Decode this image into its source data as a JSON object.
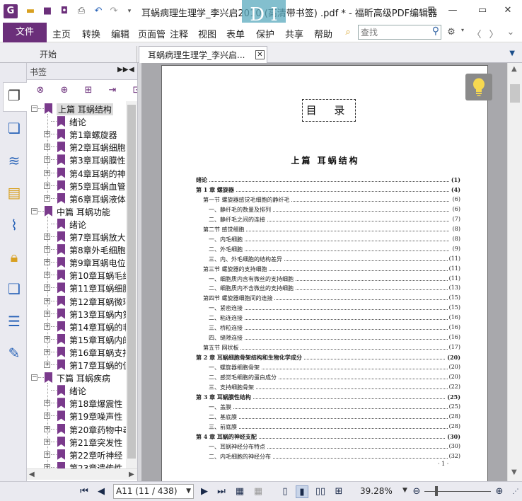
{
  "titlebar": {
    "app_icon": "G",
    "title": "耳蜗病理生理学_李兴启2010 (高清带书签) .pdf * - 福昕高级PDF编辑器",
    "overlay_text": "D  I",
    "icons": [
      "folder-icon",
      "save-icon",
      "save-as-icon",
      "print-icon",
      "undo-icon",
      "redo-icon",
      "quick-access-dropdown-icon"
    ],
    "window_icons": [
      "ribbon-options-icon",
      "minimize-icon",
      "maximize-icon",
      "close-icon"
    ]
  },
  "menubar": {
    "file": "文件",
    "items": [
      "主页",
      "转换",
      "编辑",
      "页面管",
      "注释",
      "视图",
      "表单",
      "保护",
      "共享",
      "帮助"
    ],
    "search_placeholder": "查找"
  },
  "tabs": [
    {
      "label": "开始"
    },
    {
      "label": "耳蜗病理生理学_李兴启..."
    }
  ],
  "bookmarks": {
    "header": "书签",
    "tree": [
      {
        "label": "上篇  耳蜗结构",
        "level": 0,
        "expanded": true,
        "selected": true
      },
      {
        "label": "绪论",
        "level": 1,
        "leaf": true
      },
      {
        "label": "第1章螺旋器",
        "level": 1
      },
      {
        "label": "第2章耳蜗细胞",
        "level": 1
      },
      {
        "label": "第3章耳蜗膜性",
        "level": 1
      },
      {
        "label": "第4章耳蜗的神",
        "level": 1
      },
      {
        "label": "第5章耳蜗血管",
        "level": 1
      },
      {
        "label": "第6章耳蜗液体",
        "level": 1
      },
      {
        "label": "中篇  耳蜗功能",
        "level": 0,
        "expanded": true
      },
      {
        "label": "绪论",
        "level": 1,
        "leaf": true
      },
      {
        "label": "第7章耳蜗放大",
        "level": 1
      },
      {
        "label": "第8章外毛细胞",
        "level": 1
      },
      {
        "label": "第9章耳蜗电位",
        "level": 1
      },
      {
        "label": "第10章耳蜗毛细",
        "level": 1
      },
      {
        "label": "第11章耳蜗细胞",
        "level": 1
      },
      {
        "label": "第12章耳蜗微环",
        "level": 1
      },
      {
        "label": "第13章耳蜗内第",
        "level": 1
      },
      {
        "label": "第14章耳蜗的非",
        "level": 1
      },
      {
        "label": "第15章耳蜗内的",
        "level": 1
      },
      {
        "label": "第16章耳蜗支持",
        "level": 1
      },
      {
        "label": "第17章耳蜗的值",
        "level": 1
      },
      {
        "label": "下篇  耳蜗疾病",
        "level": 0,
        "expanded": true
      },
      {
        "label": "绪论",
        "level": 1,
        "leaf": true
      },
      {
        "label": "第18章爆震性",
        "level": 1
      },
      {
        "label": "第19章噪声性",
        "level": 1
      },
      {
        "label": "第20章药物中毒",
        "level": 1
      },
      {
        "label": "第21章突发性",
        "level": 1
      },
      {
        "label": "第22章听神经",
        "level": 1
      },
      {
        "label": "第23章遗传性",
        "level": 1
      }
    ]
  },
  "document": {
    "page_title": "目 录",
    "part_title": "上篇  耳蜗结构",
    "toc": [
      {
        "label": "绪论",
        "page": "(1)",
        "indent": 0,
        "bold": true
      },
      {
        "label": "第 1 章   螺旋器",
        "page": "(4)",
        "indent": 0,
        "bold": true
      },
      {
        "label": "第一节   螺旋器感觉毛细胞的静纤毛",
        "page": "(6)",
        "indent": 1
      },
      {
        "label": "一、静纤毛的数量及排列",
        "page": "(6)",
        "indent": 2
      },
      {
        "label": "二、静纤毛之间的连接",
        "page": "(7)",
        "indent": 2
      },
      {
        "label": "第二节   感觉细胞",
        "page": "(8)",
        "indent": 1
      },
      {
        "label": "一、内毛细胞",
        "page": "(8)",
        "indent": 2
      },
      {
        "label": "二、外毛细胞",
        "page": "(9)",
        "indent": 2
      },
      {
        "label": "三、内、外毛细胞的结构差异",
        "page": "(11)",
        "indent": 2
      },
      {
        "label": "第三节   螺旋器的支持细胞",
        "page": "(11)",
        "indent": 1
      },
      {
        "label": "一、细胞质内含有微丝的支持细胞",
        "page": "(11)",
        "indent": 2
      },
      {
        "label": "二、细胞质内不含微丝的支持细胞",
        "page": "(13)",
        "indent": 2
      },
      {
        "label": "第四节   螺旋器细胞间的连接",
        "page": "(15)",
        "indent": 1
      },
      {
        "label": "一、紧密连接",
        "page": "(15)",
        "indent": 2
      },
      {
        "label": "二、粘连连接",
        "page": "(16)",
        "indent": 2
      },
      {
        "label": "三、桥粒连接",
        "page": "(16)",
        "indent": 2
      },
      {
        "label": "四、缝隙连接",
        "page": "(16)",
        "indent": 2
      },
      {
        "label": "第五节   网状板",
        "page": "(17)",
        "indent": 1
      },
      {
        "label": "第 2 章   耳蜗细胞骨架结构和生物化学成分",
        "page": "(20)",
        "indent": 0,
        "bold": true
      },
      {
        "label": "一、螺旋器细胞骨架",
        "page": "(20)",
        "indent": 2
      },
      {
        "label": "二、感觉毛细胞的蛋白成分",
        "page": "(20)",
        "indent": 2
      },
      {
        "label": "三、支持细胞骨架",
        "page": "(22)",
        "indent": 2
      },
      {
        "label": "第 3 章   耳蜗膜性结构",
        "page": "(25)",
        "indent": 0,
        "bold": true
      },
      {
        "label": "一、盖膜",
        "page": "(25)",
        "indent": 2
      },
      {
        "label": "二、基底膜",
        "page": "(28)",
        "indent": 2
      },
      {
        "label": "三、前庭膜",
        "page": "(28)",
        "indent": 2
      },
      {
        "label": "第 4 章   耳蜗的神经支配",
        "page": "(30)",
        "indent": 0,
        "bold": true
      },
      {
        "label": "一、耳蜗神经分布特点",
        "page": "(30)",
        "indent": 2
      },
      {
        "label": "二、内毛细胞的神经分布",
        "page": "(32)",
        "indent": 2
      }
    ],
    "page_number": "· 1 ·"
  },
  "statusbar": {
    "page_indicator": "A11 (11 / 438)",
    "zoom": "39.28%"
  }
}
